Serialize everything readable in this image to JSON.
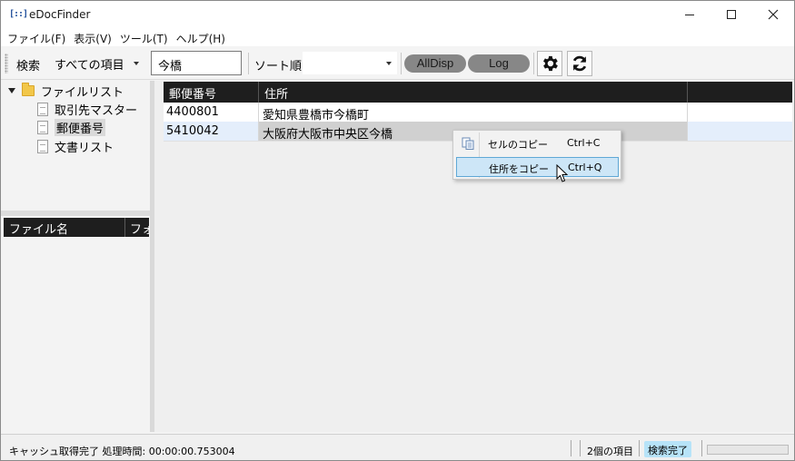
{
  "window": {
    "title": "eDocFinder"
  },
  "menu": [
    {
      "label": "ファイル(F)"
    },
    {
      "label": "表示(V)"
    },
    {
      "label": "ツール(T)"
    },
    {
      "label": "ヘルプ(H)"
    }
  ],
  "toolbar": {
    "search_label": "検索",
    "scope_value": "すべての項目",
    "search_value": "今橋",
    "sort_label": "ソート順",
    "sort_value": "",
    "alldisp_label": "AllDisp",
    "log_label": "Log",
    "settings_icon": "gear-icon",
    "refresh_icon": "refresh-icon"
  },
  "tree": {
    "root_label": "ファイルリスト",
    "items": [
      {
        "label": "取引先マスター"
      },
      {
        "label": "郵便番号"
      },
      {
        "label": "文書リスト"
      }
    ]
  },
  "files": {
    "columns": [
      "ファイル名",
      "フォルダ"
    ]
  },
  "grid": {
    "columns": [
      "郵便番号",
      "住所"
    ],
    "rows": [
      {
        "zip": "4400801",
        "address": "愛知県豊橋市今橋町"
      },
      {
        "zip": "5410042",
        "address": "大阪府大阪市中央区今橋"
      }
    ]
  },
  "context_menu": {
    "items": [
      {
        "label": "セルのコピー",
        "shortcut": "Ctrl+C",
        "icon": "copy-icon"
      },
      {
        "label": "住所をコピー",
        "shortcut": "Ctrl+Q"
      }
    ]
  },
  "status": {
    "main": "キャッシュ取得完了 処理時間: 00:00:00.753004",
    "count": "2個の項目",
    "badge": "検索完了",
    "progress": 0
  },
  "colors": {
    "header_bg": "#1e1e1e",
    "selected_row": "#e4eefb",
    "menu_highlight": "#cde6f7",
    "badge_bg": "#b7e3f8",
    "pill_bg": "#878787"
  }
}
